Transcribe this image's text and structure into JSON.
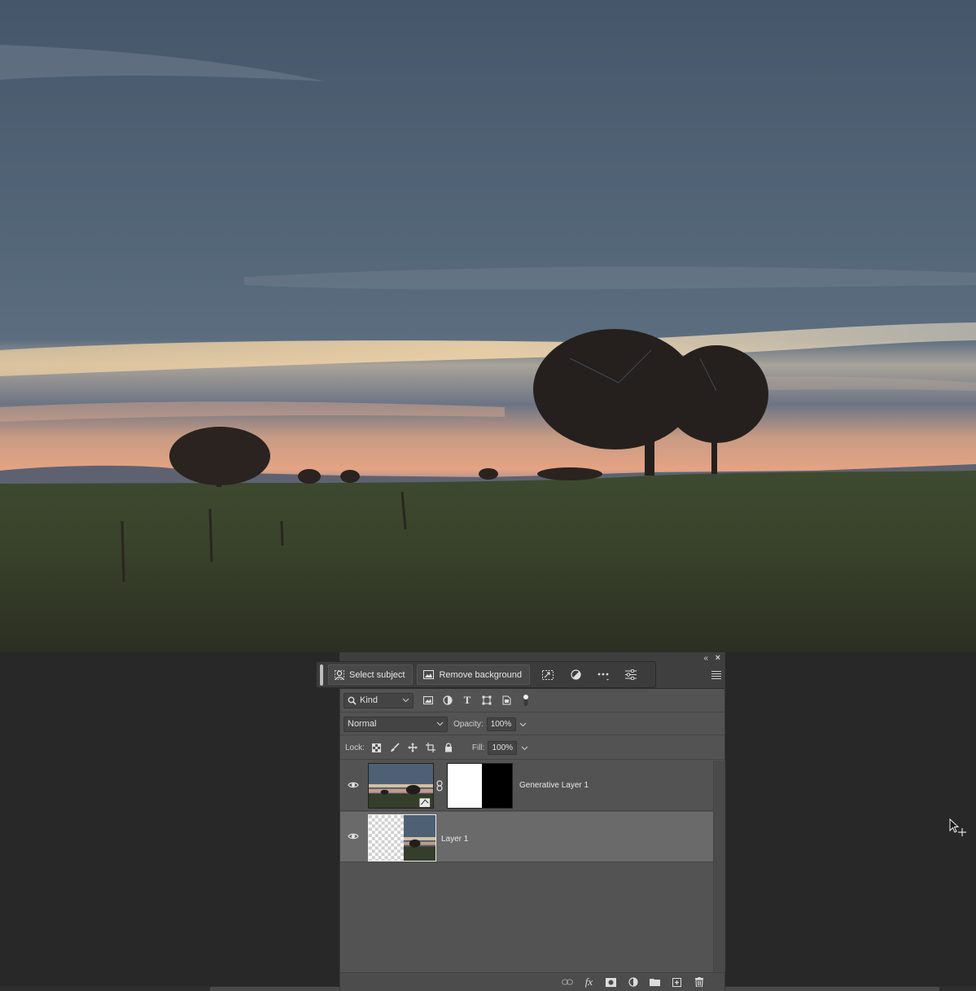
{
  "taskbar": {
    "select_subject_label": "Select subject",
    "remove_background_label": "Remove background"
  },
  "layers_panel": {
    "filter": {
      "kind_label": "Kind"
    },
    "blend_mode": "Normal",
    "opacity_label": "Opacity:",
    "opacity_value": "100%",
    "lock_label": "Lock:",
    "fill_label": "Fill:",
    "fill_value": "100%",
    "layers": [
      {
        "name": "Generative Layer 1",
        "visible": true,
        "selected": false,
        "has_mask": true
      },
      {
        "name": "Layer 1",
        "visible": true,
        "selected": true,
        "has_mask": false
      }
    ]
  },
  "colors": {
    "panel_bg": "#535353",
    "selected_layer": "#6a6a6a",
    "workspace": "#282828"
  }
}
